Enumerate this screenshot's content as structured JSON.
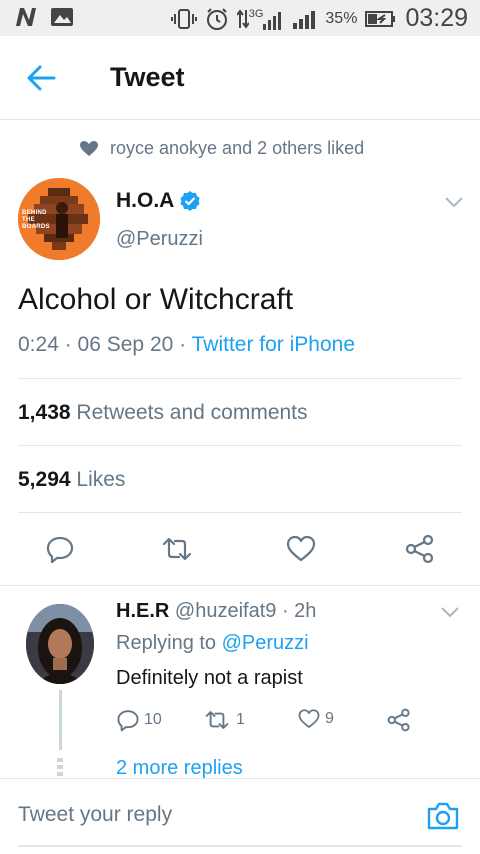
{
  "status_bar": {
    "network": "3G",
    "battery_percent": "35%",
    "time": "03:29"
  },
  "header": {
    "title": "Tweet"
  },
  "social_context": {
    "text": "royce anokye and 2 others liked"
  },
  "tweet": {
    "author_name": "H.O.A",
    "author_handle": "@Peruzzi",
    "avatar_text": "BEHIND THE BOARDS",
    "text": "Alcohol or Witchcraft",
    "time": "0:24",
    "date": "06 Sep 20",
    "source": "Twitter for iPhone",
    "retweets_count": "1,438",
    "retweets_label": "Retweets and comments",
    "likes_count": "5,294",
    "likes_label": "Likes"
  },
  "reply": {
    "name": "H.E.R",
    "handle": "@huzeifat9",
    "time": "2h",
    "replying_prefix": "Replying to",
    "replying_to": "@Peruzzi",
    "text": "Definitely not a rapist",
    "reply_count": "10",
    "retweet_count": "1",
    "like_count": "9",
    "more_replies": "2 more replies"
  },
  "composer": {
    "placeholder": "Tweet your reply"
  },
  "colors": {
    "accent": "#1da1f2",
    "secondary_text": "#657786",
    "avatar_orange": "#f07b2a"
  }
}
